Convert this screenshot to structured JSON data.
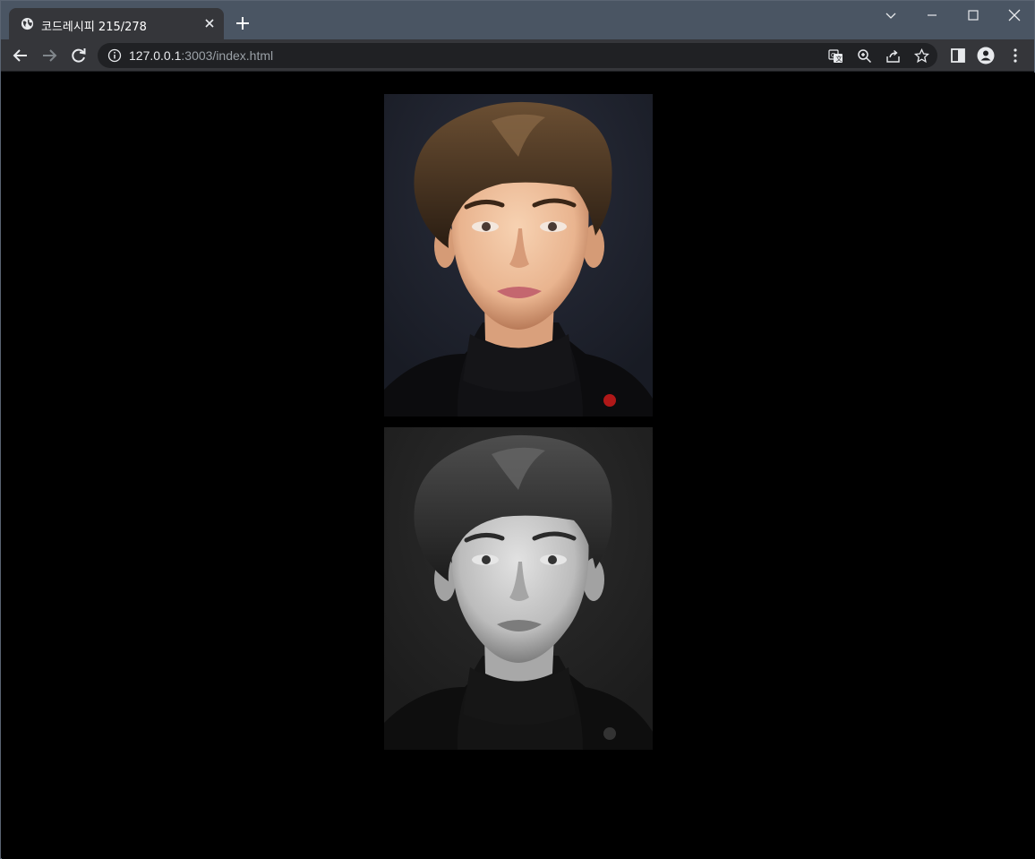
{
  "browser": {
    "tab": {
      "title": "코드레시피 215/278"
    },
    "url": {
      "host": "127.0.0.1",
      "rest": ":3003/index.html"
    }
  },
  "page": {
    "images": [
      {
        "name": "portrait-color",
        "style": "color"
      },
      {
        "name": "portrait-grayscale",
        "style": "grayscale"
      }
    ]
  },
  "colors": {
    "tabstrip": "#4a5563",
    "toolbar": "#35363a",
    "omnibox": "#202124",
    "page_background": "#000000"
  }
}
